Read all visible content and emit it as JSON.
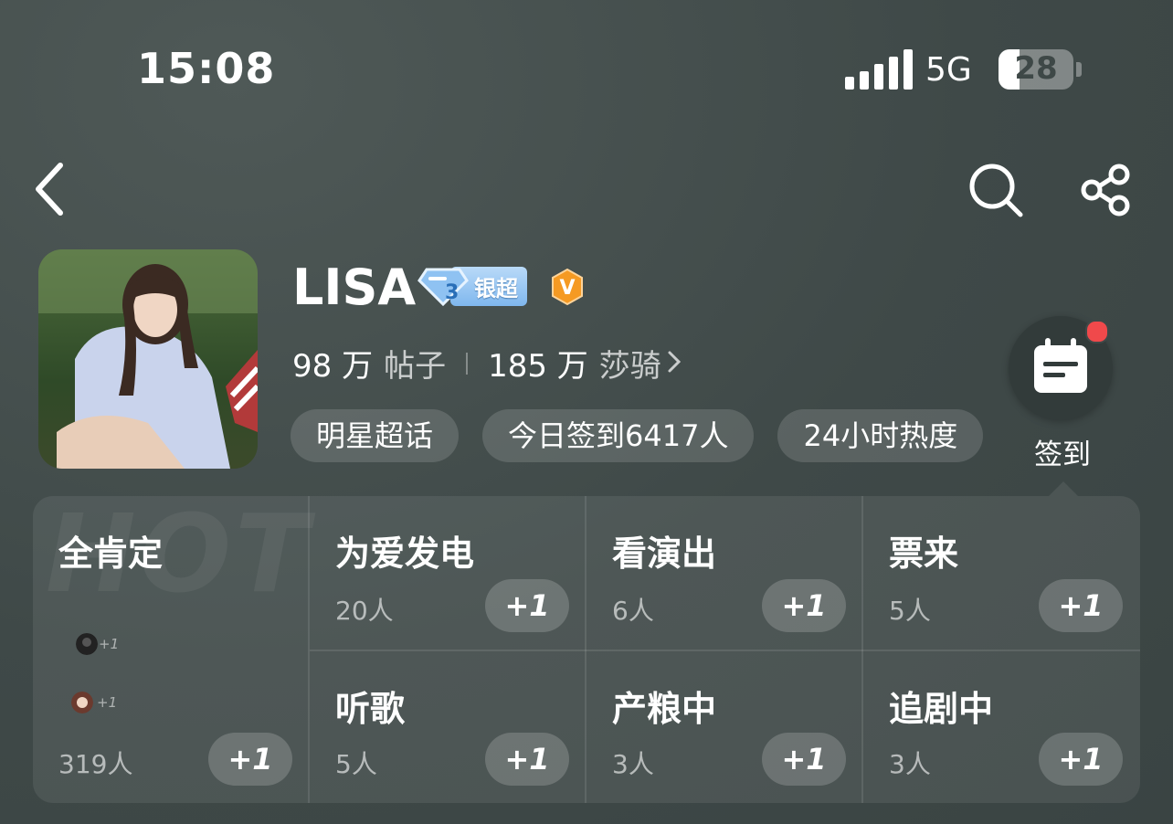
{
  "status_bar": {
    "time": "15:08",
    "network": "5G",
    "battery": "28"
  },
  "profile": {
    "name": "LISA",
    "badge_label": "银超",
    "badge_level": "3",
    "verified_mark": "V",
    "posts_count": "98 万",
    "posts_label": "帖子",
    "fans_count": "185 万",
    "fans_label": "莎骑"
  },
  "tags": [
    "明星超话",
    "今日签到6417人",
    "24小时热度"
  ],
  "sign_in": {
    "label": "签到"
  },
  "panel": {
    "watermark": "HOT",
    "featured": {
      "name": "全肯定",
      "count": "319人",
      "button": "+1",
      "mini_plus": "+1"
    },
    "cells": [
      {
        "name": "为爱发电",
        "count": "20人",
        "button": "+1"
      },
      {
        "name": "看演出",
        "count": "6人",
        "button": "+1"
      },
      {
        "name": "票来",
        "count": "5人",
        "button": "+1"
      },
      {
        "name": "听歌",
        "count": "5人",
        "button": "+1"
      },
      {
        "name": "产粮中",
        "count": "3人",
        "button": "+1"
      },
      {
        "name": "追剧中",
        "count": "3人",
        "button": "+1"
      }
    ]
  },
  "icons": [
    "back-icon",
    "search-icon",
    "share-icon",
    "calendar-icon",
    "signal-icon",
    "battery-icon",
    "chevron-right-icon"
  ],
  "colors": {
    "background": "#3f4948",
    "badge_blue": "#7fb7ee",
    "verified_orange": "#f59a23",
    "notification_red": "#f0494b"
  },
  "battery_level": 0.28
}
